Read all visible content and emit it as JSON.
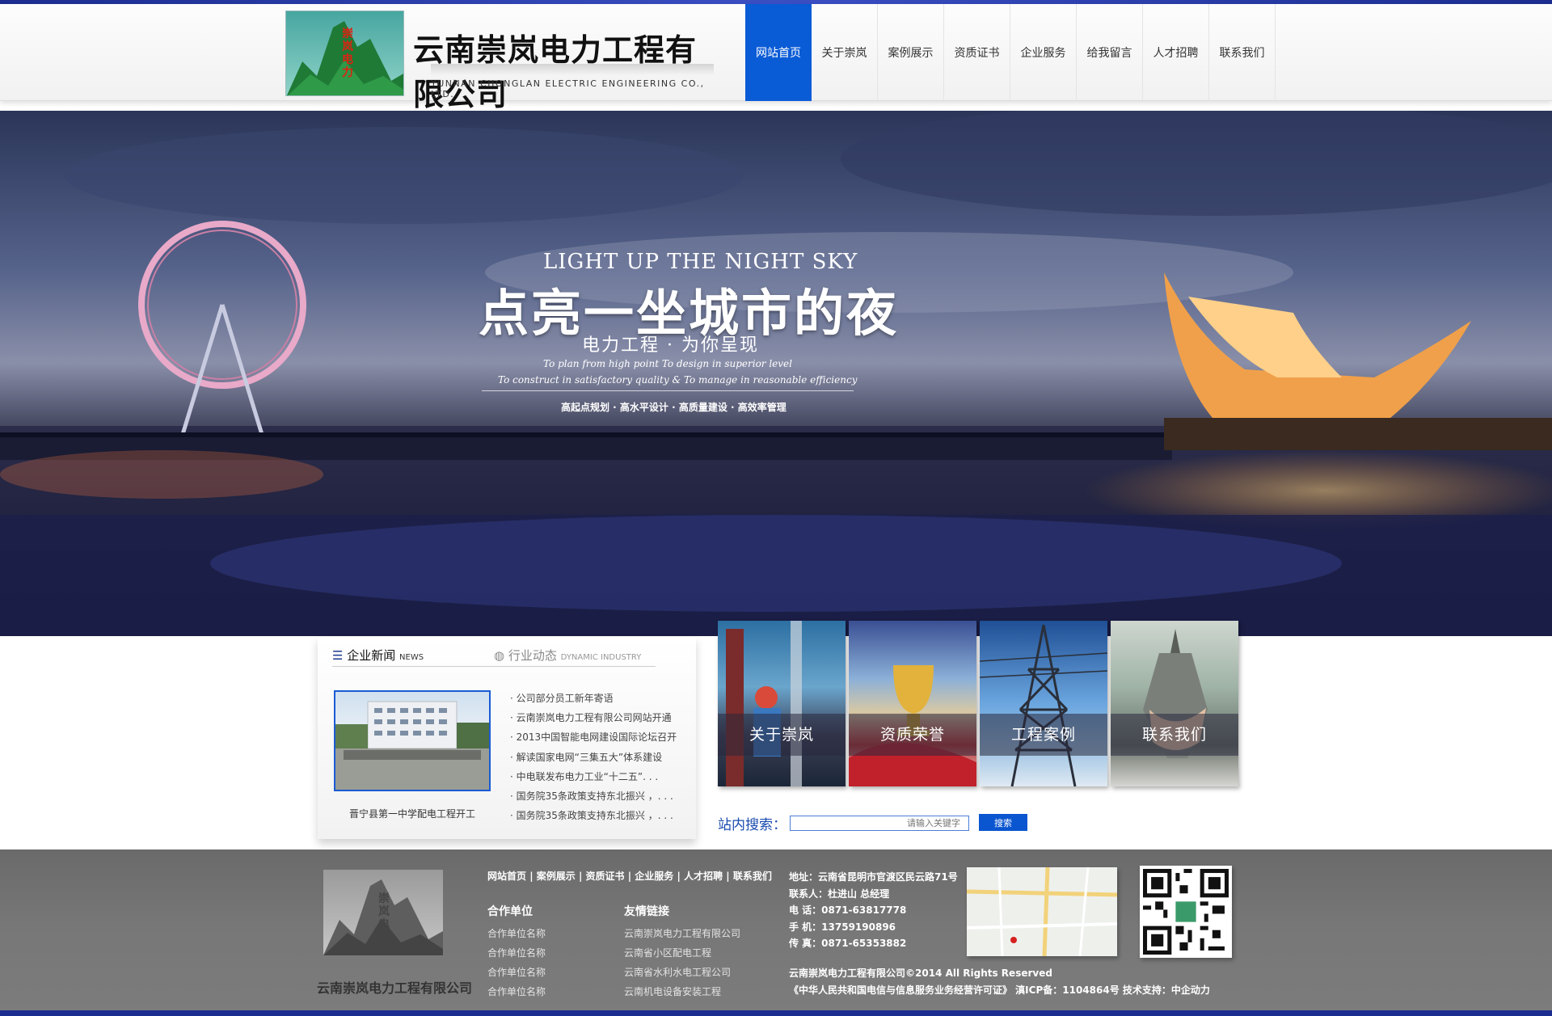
{
  "header": {
    "logo_mark_text": "崇岚电力",
    "logo_cn": "云南崇岚电力工程有限公司",
    "logo_en": "YUNNAN CHONGLAN ELECTRIC ENGINEERING CO., LTD."
  },
  "nav": {
    "items": [
      "网站首页",
      "关于崇岚",
      "案例展示",
      "资质证书",
      "企业服务",
      "给我留言",
      "人才招聘",
      "联系我们"
    ],
    "active_index": 0
  },
  "banner": {
    "en_title": "LIGHT UP THE NIGHT SKY",
    "cn_title": "点亮一坐城市的夜",
    "subtitle": "电力工程 · 为你呈现",
    "line1": "To plan from high point   To design in superior level",
    "line2": "To construct in satisfactory quality      &      To manage in reasonable efficiency",
    "tagline": "高起点规划 · 高水平设计 · 高质量建设 · 高效率管理"
  },
  "news": {
    "tab_active": "企业新闻",
    "tab_active_en": "NEWS",
    "tab_other": "行业动态",
    "tab_other_en": "DYNAMIC INDUSTRY",
    "image_caption": "晋宁县第一中学配电工程开工",
    "items": [
      "· 公司部分员工新年寄语",
      "· 云南崇岚电力工程有限公司网站开通",
      "· 2013中国智能电网建设国际论坛召开",
      "· 解读国家电网“三集五大”体系建设",
      "· 中电联发布电力工业“十二五”. . .",
      "· 国务院35条政策支持东北振兴 ，. . .",
      "· 国务院35条政策支持东北振兴 ，. . ."
    ]
  },
  "tiles": [
    "关于崇岚",
    "资质荣誉",
    "工程案例",
    "联系我们"
  ],
  "search": {
    "label": "站内搜索：",
    "placeholder": "请输入关键字",
    "button": "搜索"
  },
  "footer": {
    "logo_text": "崇岚电力",
    "company": "云南崇岚电力工程有限公司",
    "nav": [
      "网站首页",
      "案例展示",
      "资质证书",
      "企业服务",
      "人才招聘",
      "联系我们"
    ],
    "partners_title": "合作单位",
    "partners": [
      "合作单位名称",
      "合作单位名称",
      "合作单位名称",
      "合作单位名称"
    ],
    "links_title": "友情链接",
    "links": [
      "云南崇岚电力工程有限公司",
      "云南省小区配电工程",
      "云南省水利水电工程公司",
      "云南机电设备安装工程"
    ],
    "contact": {
      "address": "地址：云南省昆明市官渡区民云路71号",
      "contact_person": "联系人：杜进山 总经理",
      "phone": "电  话：0871-63817778",
      "mobile": "手  机：13759190896",
      "fax": "传  真：0871-65353882"
    },
    "copyright": "云南崇岚电力工程有限公司©2014 All Rights Reserved",
    "icp": "《中华人民共和国电信与信息服务业务经营许可证》  滇ICP备：1104864号    技术支持：中企动力"
  },
  "colors": {
    "accent": "#0a5bd6",
    "top_bar": "#1b2d8f",
    "footer_bg": "#737373"
  }
}
